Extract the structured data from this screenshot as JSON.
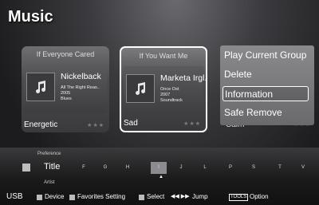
{
  "page_title": "Music",
  "cards": [
    {
      "title": "If Everyone Cared",
      "artist": "Nickelback",
      "album": "All The Right Reas..",
      "year": "2005",
      "genre": "Blues",
      "mood": "Energetic",
      "stars": "★★★",
      "icon": "music-note-icon"
    },
    {
      "title": "If You Want Me",
      "artist": "Marketa Irgl...",
      "album": "Once Ost",
      "year": "2007",
      "genre": "Soundtrack",
      "mood": "Sad",
      "stars": "★★★",
      "icon": "music-note-icon"
    }
  ],
  "hidden_card": {
    "mood": "Calm",
    "stars": "★★★"
  },
  "context_menu": {
    "items": [
      "Play Current Group",
      "Delete",
      "Information",
      "Safe Remove"
    ],
    "highlighted": "Information"
  },
  "sort_bar": {
    "preference_label": "Preference",
    "current_label": "Title",
    "artist_label": "Artist",
    "letters": [
      "F",
      "G",
      "H",
      "I",
      "J",
      "L",
      "P",
      "S",
      "T",
      "V"
    ],
    "active_letter": "I"
  },
  "footer": {
    "source": "USB",
    "device": "Device",
    "favorites": "Favorites Setting",
    "select": "Select",
    "jump_arrows": "◀◀ ▶▶",
    "jump": "Jump",
    "tools": "TOOLS",
    "option": "Option"
  },
  "colors": {
    "red_button": "#cfcfd1",
    "accent": "#8c8c90"
  }
}
